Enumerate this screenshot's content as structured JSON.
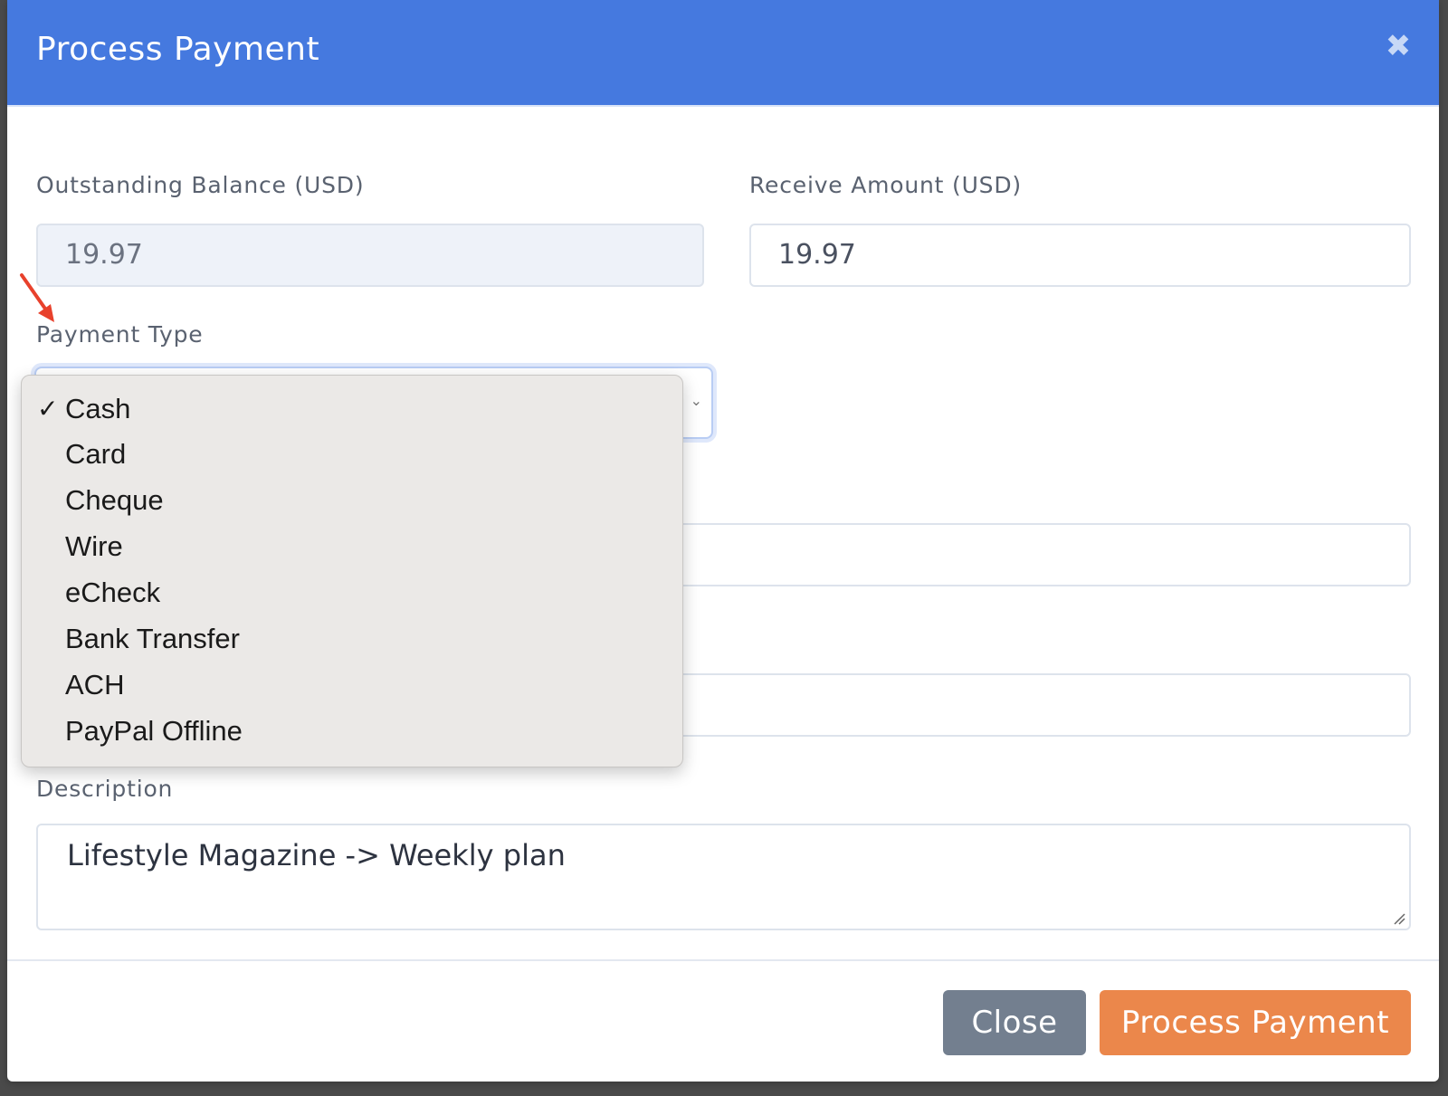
{
  "modal": {
    "title": "Process Payment",
    "close_icon": "close-icon"
  },
  "form": {
    "outstanding_balance": {
      "label": "Outstanding Balance (USD)",
      "value": "19.97"
    },
    "receive_amount": {
      "label": "Receive Amount (USD)",
      "value": "19.97"
    },
    "payment_type": {
      "label": "Payment Type",
      "selected": "Cash",
      "options": [
        "Cash",
        "Card",
        "Cheque",
        "Wire",
        "eCheck",
        "Bank Transfer",
        "ACH",
        "PayPal Offline"
      ],
      "check_mark": "✓"
    },
    "description": {
      "label": "Description",
      "value": "Lifestyle Magazine -> Weekly plan"
    }
  },
  "footer": {
    "close_label": "Close",
    "process_label": "Process Payment"
  },
  "colors": {
    "header": "#4579df",
    "close_button": "#737f8f",
    "process_button": "#eb874b",
    "annotation_arrow": "#e8412c"
  }
}
